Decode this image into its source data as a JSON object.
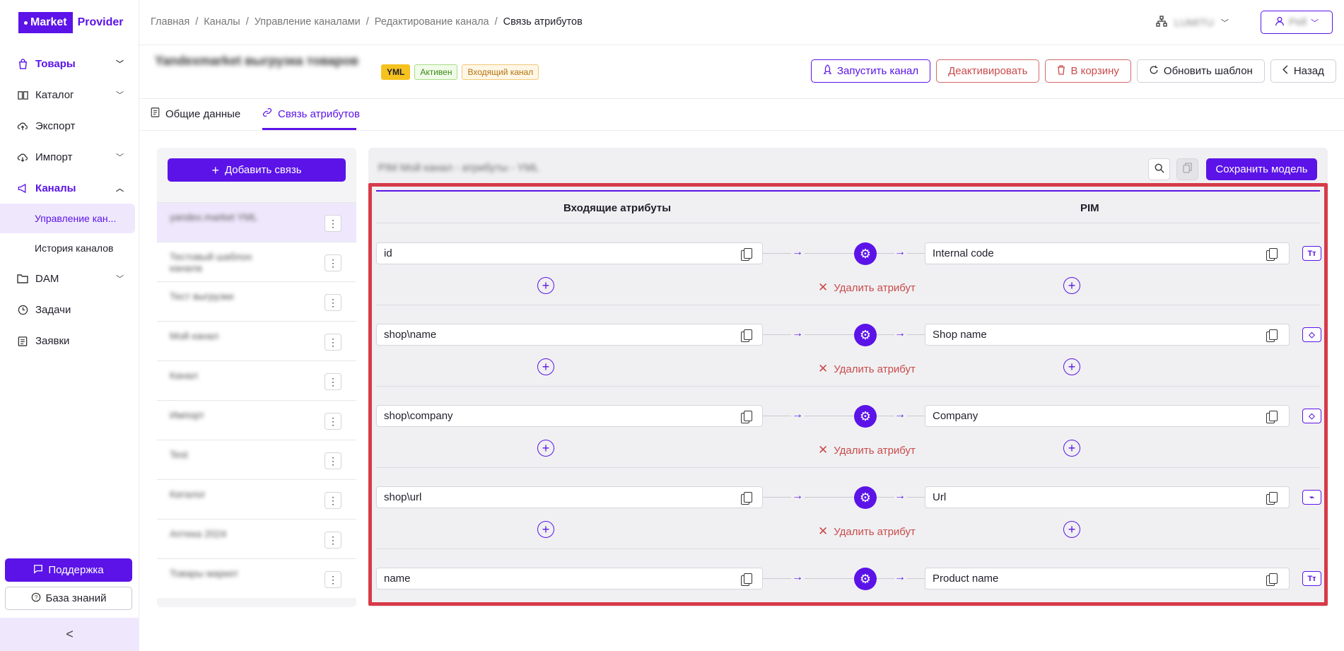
{
  "logo": {
    "box": "Market",
    "text": "Provider"
  },
  "sidebar": {
    "items": [
      {
        "label": "Товары",
        "icon": "bag-icon"
      },
      {
        "label": "Каталог",
        "icon": "book-icon"
      },
      {
        "label": "Экспорт",
        "icon": "cloud-upload-icon"
      },
      {
        "label": "Импорт",
        "icon": "cloud-download-icon"
      },
      {
        "label": "Каналы",
        "icon": "megaphone-icon"
      },
      {
        "label": "DAM",
        "icon": "folder-icon"
      },
      {
        "label": "Задачи",
        "icon": "clock-icon"
      },
      {
        "label": "Заявки",
        "icon": "clipboard-icon"
      }
    ],
    "sub": [
      "Управление кан...",
      "История каналов"
    ],
    "support": "Поддержка",
    "kb": "База знаний",
    "collapse": "<"
  },
  "breadcrumb": [
    "Главная",
    "/",
    "Каналы",
    "/",
    "Управление каналами",
    "/",
    "Редактирование канала",
    "/",
    "Связь атрибутов"
  ],
  "org_name": "LUMITU",
  "user_name": "Pell",
  "channel_title": "Yandexmarket выгрузка товаров",
  "badges": {
    "yml": "YML",
    "active": "Активен",
    "incoming": "Входящий канал"
  },
  "actions": {
    "run": "Запустить канал",
    "deactivate": "Деактивировать",
    "trash": "В корзину",
    "refresh": "Обновить шаблон",
    "back": "Назад"
  },
  "tabs": {
    "general": "Общие данные",
    "links": "Связь атрибутов"
  },
  "left": {
    "add": "Добавить связь",
    "items": [
      "yandex.market YML",
      "Тестовый шаблон канала",
      "Тест выгрузки",
      "Мой канал",
      "Канал",
      "Импорт",
      "Test",
      "Каталог",
      "Аптека 2024",
      "Товары маркет"
    ]
  },
  "main": {
    "title": "PIM Мой канал - атрибуты - YML",
    "save": "Сохранить модель",
    "col_in": "Входящие атрибуты",
    "col_pim": "PIM",
    "delete": "Удалить атрибут",
    "rows": [
      {
        "in": "id",
        "pim": "Internal code",
        "type": "Tт"
      },
      {
        "in": "shop\\name",
        "pim": "Shop name",
        "type": "◇"
      },
      {
        "in": "shop\\company",
        "pim": "Company",
        "type": "◇"
      },
      {
        "in": "shop\\url",
        "pim": "Url",
        "type": "⌁"
      },
      {
        "in": "name",
        "pim": "Product name",
        "type": "Tт"
      }
    ]
  },
  "colors": {
    "accent": "#5b13e8",
    "danger": "#d73a49"
  }
}
